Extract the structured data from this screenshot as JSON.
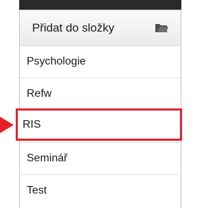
{
  "dropdown": {
    "button_label": "Přidat do složky",
    "button_icon": "folder-icon",
    "items": [
      {
        "label": "Psychologie"
      },
      {
        "label": "Refw"
      },
      {
        "label": "RIS",
        "highlighted": true
      },
      {
        "label": "Seminář"
      },
      {
        "label": "Test"
      }
    ]
  },
  "colors": {
    "highlight_border": "#e3202a",
    "header_strip": "#2a2a2a"
  }
}
